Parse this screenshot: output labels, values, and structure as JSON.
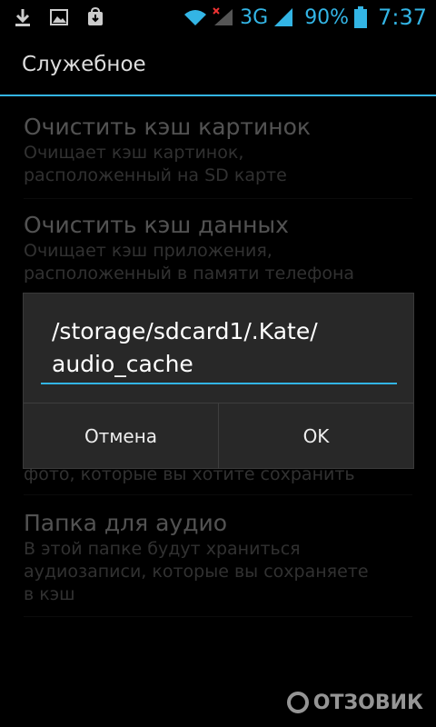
{
  "status_bar": {
    "icons_left": [
      "download-icon",
      "image-icon",
      "store-icon"
    ],
    "network": "3G",
    "battery": "90%",
    "time": "7:37",
    "accent": "#33b5e5"
  },
  "action_bar": {
    "title": "Служебное"
  },
  "list": {
    "items": [
      {
        "title": "Очистить кэш картинок",
        "summary_line1": "Очищает кэш картинок,",
        "summary_line2": "расположенный на SD карте"
      },
      {
        "title": "Очистить кэш данных",
        "summary_line1": "Очищает кэш приложения,",
        "summary_line2": "расположенный в памяти телефона"
      },
      {
        "summary_line2": "фото, которые вы хотите сохранить"
      },
      {
        "title": "Папка для аудио",
        "summary_line1": "В этой папке будут храниться",
        "summary_line2": "аудиозаписи, которые вы сохраняете",
        "summary_line3": "в кэш"
      }
    ]
  },
  "dialog": {
    "input_line1": "/storage/sdcard1/.Kate/",
    "input_line2": "audio_cache",
    "cancel_label": "Отмена",
    "ok_label": "OK"
  },
  "watermark": {
    "text": "ОТЗОВИК"
  }
}
